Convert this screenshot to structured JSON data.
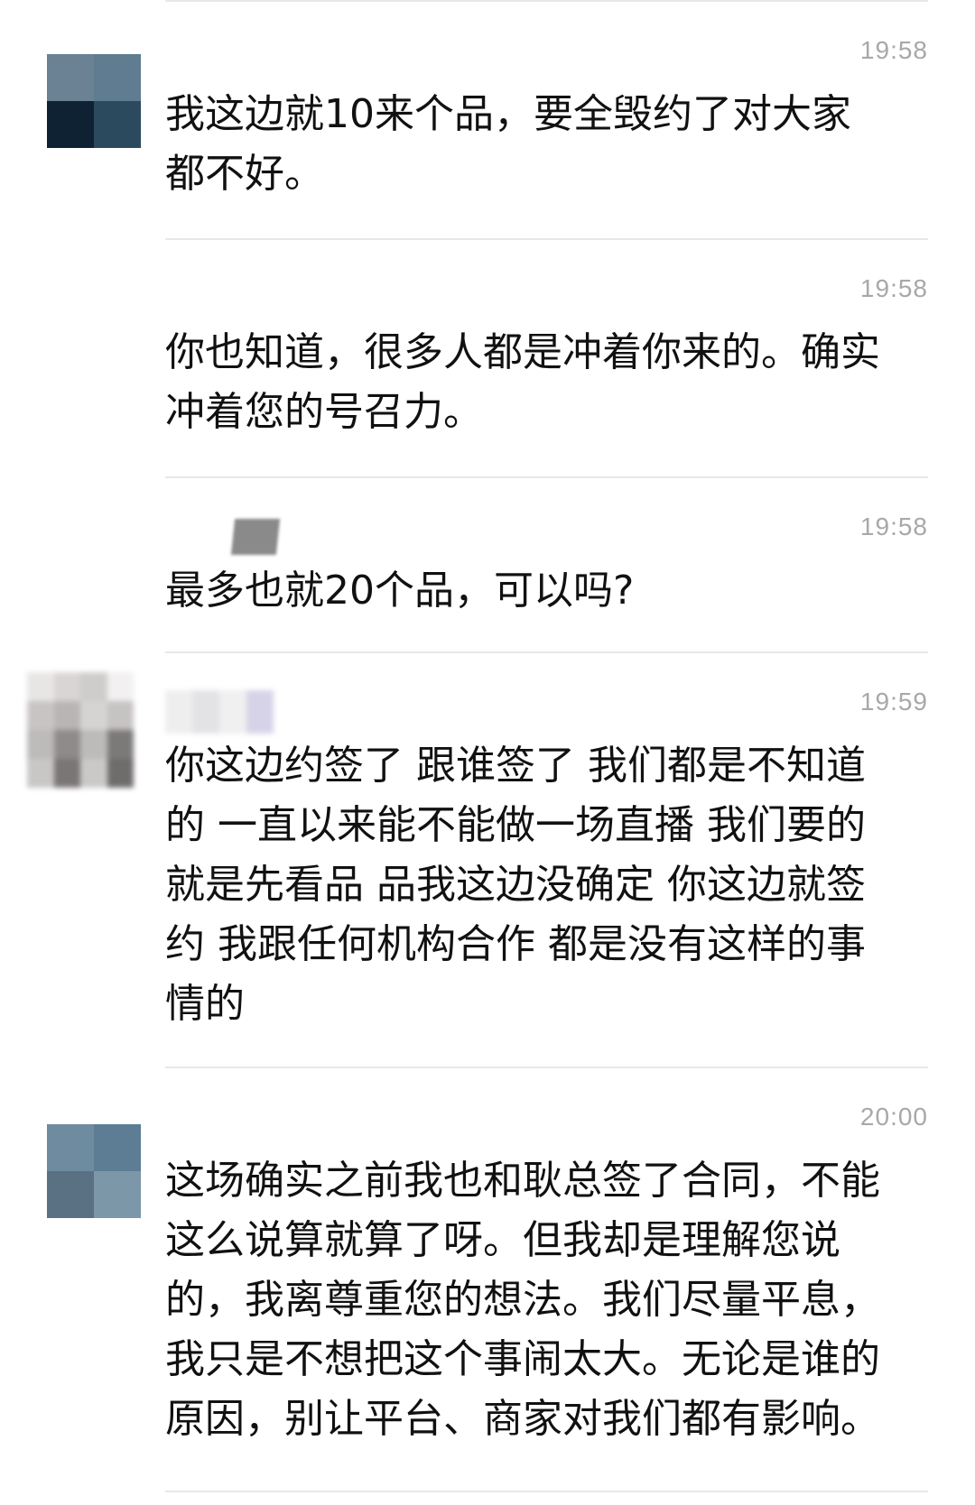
{
  "messages": [
    {
      "time": "19:58",
      "lines": [
        "我这边就10来个品，要全毁约了对大家",
        "都不好。"
      ]
    },
    {
      "time": "19:58",
      "lines": [
        "你也知道，很多人都是冲着你来的。确实",
        "冲着您的号召力。"
      ]
    },
    {
      "time": "19:58",
      "lines": [
        "最多也就20个品，可以吗?"
      ]
    },
    {
      "time": "19:59",
      "lines": [
        "你这边约签了 跟谁签了 我们都是不知道",
        "的 一直以来能不能做一场直播 我们要的",
        "就是先看品 品我这边没确定 你这边就签",
        "约 我跟任何机构合作 都是没有这样的事",
        "情的"
      ]
    },
    {
      "time": "20:00",
      "lines": [
        "这场确实之前我也和耿总签了合同，不能",
        "这么说算就算了呀。但我却是理解您说",
        "的，我离尊重您的想法。我们尽量平息，",
        "我只是不想把这个事闹太大。无论是谁的",
        "原因，别让平台、商家对我们都有影响。"
      ]
    }
  ],
  "colors": {
    "avatar_a": [
      "#6a8294",
      "#5f7c91",
      "#0f2233",
      "#2c4a5e"
    ],
    "avatar_b": [
      "#6f8ba0",
      "#5c7d94",
      "#5a7184",
      "#7c97a8"
    ]
  }
}
